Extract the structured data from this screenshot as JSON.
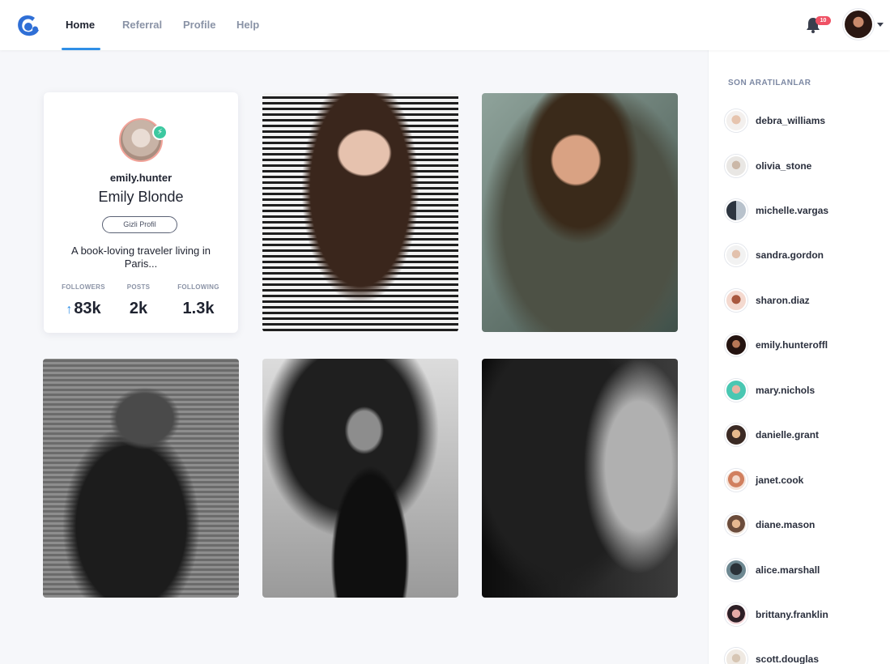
{
  "nav": {
    "tabs": [
      {
        "label": "Home",
        "active": true
      },
      {
        "label": "Referral",
        "active": false
      },
      {
        "label": "Profile",
        "active": false
      },
      {
        "label": "Help",
        "active": false
      }
    ],
    "notification_count": "10",
    "icons": {
      "logo": "brand-logo-icon",
      "bell": "bell-icon",
      "caret": "caret-down-icon"
    }
  },
  "profile": {
    "username": "emily.hunter",
    "full_name": "Emily Blonde",
    "privacy_label": "Gizli Profil",
    "bio": "A book-loving traveler living in Paris...",
    "stats": [
      {
        "label": "FOLLOWERS",
        "value": "83k",
        "trend": "up"
      },
      {
        "label": "POSTS",
        "value": "2k"
      },
      {
        "label": "FOLLOWING",
        "value": "1.3k"
      }
    ]
  },
  "sidebar": {
    "title": "SON ARATILANLAR",
    "users": [
      "debra_williams",
      "olivia_stone",
      "michelle.vargas",
      "sandra.gordon",
      "sharon.diaz",
      "emily.hunteroffl",
      "mary.nichols",
      "danielle.grant",
      "janet.cook",
      "diane.mason",
      "alice.marshall",
      "brittany.franklin",
      "scott.douglas"
    ]
  },
  "colors": {
    "accent": "#2f8fe6",
    "badge": "#ef5164",
    "online": "#3cc8a0"
  }
}
